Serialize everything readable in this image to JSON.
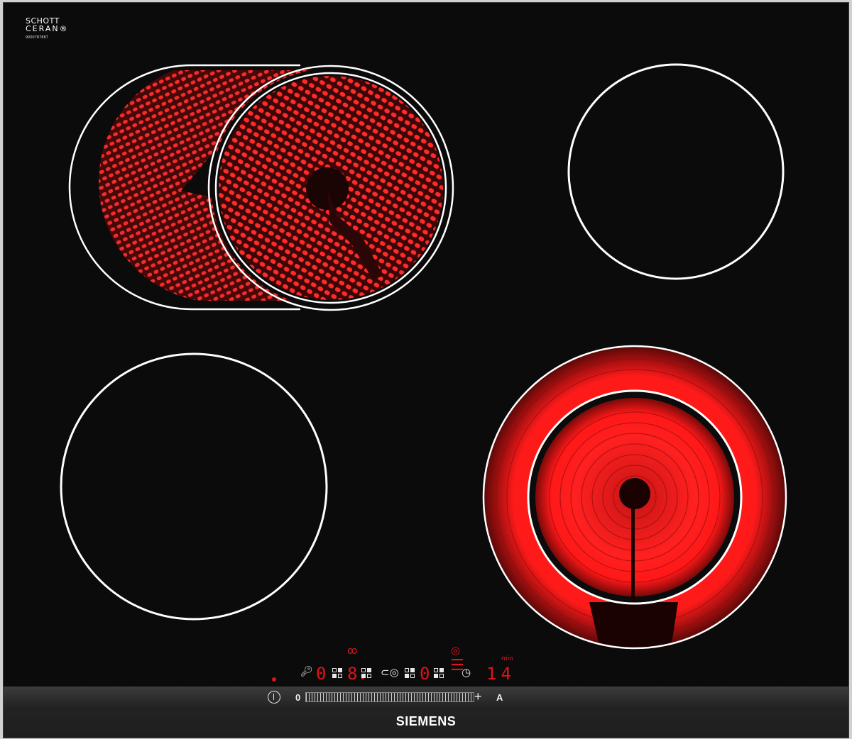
{
  "logo": {
    "line1": "SCHOTT",
    "line2": "CERAN®",
    "code": "9000787887"
  },
  "brand": "SIEMENS",
  "controls": {
    "zone_display_1": "0",
    "zone_display_2": "8.",
    "zone_display_3": "0",
    "timer_value": "14",
    "timer_unit": "min",
    "slider_min_label": "0",
    "slider_max_label": "+",
    "auto_label": "A"
  },
  "zones": [
    {
      "name": "front-left-dual-zone",
      "state": "on"
    },
    {
      "name": "back-right-zone",
      "state": "off"
    },
    {
      "name": "front-left-zone",
      "state": "off"
    },
    {
      "name": "front-right-dual-zone",
      "state": "on"
    }
  ],
  "colors": {
    "glass": "#0b0b0b",
    "heat": "#ff1f1f",
    "display": "#e0141a",
    "ring": "#ffffff"
  },
  "icons": [
    "power-icon",
    "child-lock-icon",
    "dual-ring-icon",
    "roasting-zone-icon",
    "timer-icon",
    "extended-zone-icon",
    "dual-circuit-indicator-icon"
  ]
}
